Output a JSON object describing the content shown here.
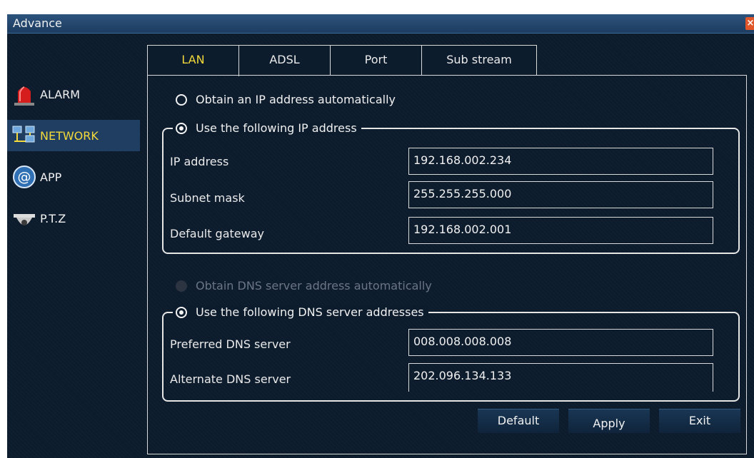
{
  "window": {
    "title": "Advance"
  },
  "sidebar": {
    "items": [
      {
        "label": "ALARM",
        "icon": "alarm-siren-icon",
        "active": false
      },
      {
        "label": "NETWORK",
        "icon": "network-computers-icon",
        "active": true
      },
      {
        "label": "APP",
        "icon": "at-sign-icon",
        "active": false
      },
      {
        "label": "P.T.Z",
        "icon": "dome-camera-icon",
        "active": false
      }
    ]
  },
  "tabs": [
    {
      "label": "LAN",
      "active": true
    },
    {
      "label": "ADSL",
      "active": false
    },
    {
      "label": "Port",
      "active": false
    },
    {
      "label": "Sub stream",
      "active": false
    }
  ],
  "ip": {
    "auto_label": "Obtain an IP address automatically",
    "manual_label": "Use the following IP address",
    "fields": [
      {
        "label": "IP address",
        "value": "192.168.002.234"
      },
      {
        "label": "Subnet mask",
        "value": "255.255.255.000"
      },
      {
        "label": "Default gateway",
        "value": "192.168.002.001"
      }
    ]
  },
  "dns": {
    "auto_label": "Obtain DNS server address automatically",
    "manual_label": "Use the following DNS server addresses",
    "fields": [
      {
        "label": "Preferred DNS server",
        "value": "008.008.008.008"
      },
      {
        "label": "Alternate DNS server",
        "value": "202.096.134.133"
      }
    ]
  },
  "buttons": {
    "default": "Default",
    "apply": "Apply",
    "exit": "Exit"
  },
  "colors": {
    "background": "#0d1c2d",
    "accent_yellow": "#f4d93a",
    "titlebar": "#24466d",
    "close": "#e2572a"
  }
}
